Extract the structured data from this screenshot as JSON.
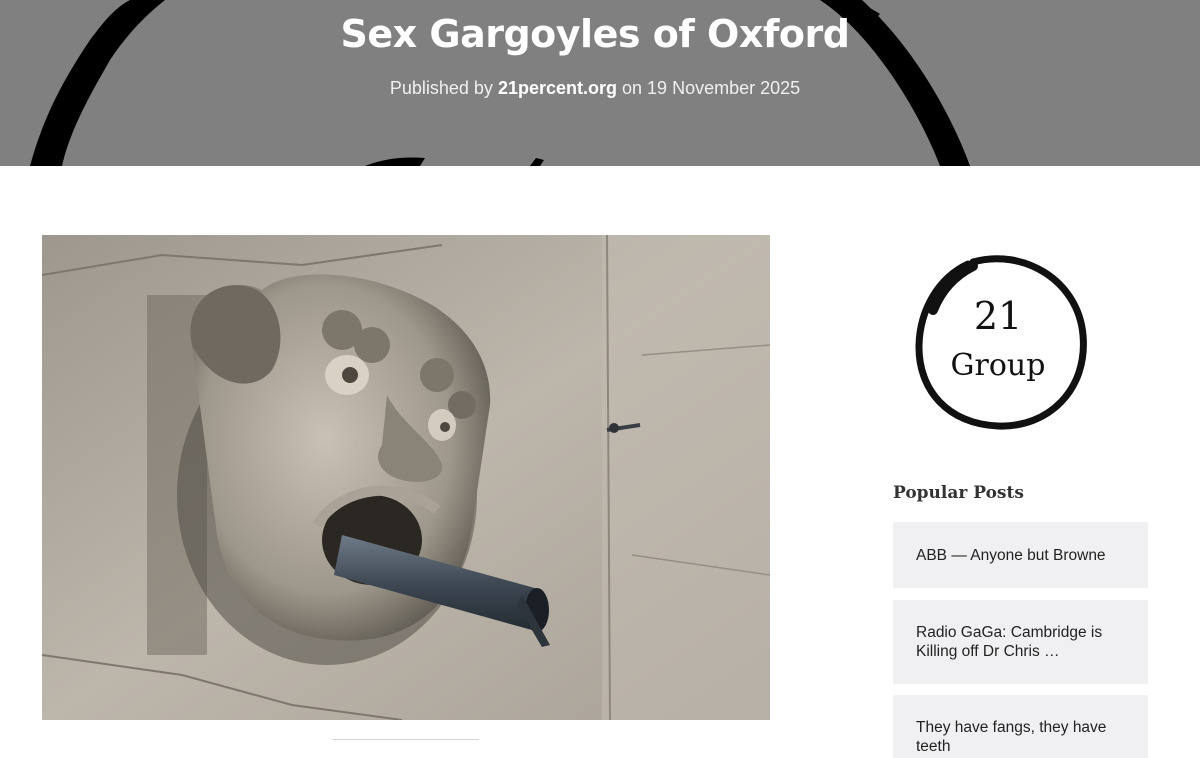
{
  "header": {
    "title": "Sex Gargoyles of Oxford",
    "meta_prefix": "Published by",
    "author": "21percent.org",
    "meta_middle": "on",
    "date": "19 November 2025",
    "background_color": "#808080"
  },
  "featured_image": {
    "subject": "stone gargoyle with pipe spout"
  },
  "sidebar": {
    "logo": {
      "line1": "21",
      "line2": "Group"
    },
    "popular_title": "Popular Posts",
    "posts": [
      {
        "title": "ABB — Anyone but Browne"
      },
      {
        "title": "Radio GaGa: Cambridge is Killing off Dr Chris …"
      },
      {
        "title": "They have fangs, they have teeth"
      }
    ]
  }
}
